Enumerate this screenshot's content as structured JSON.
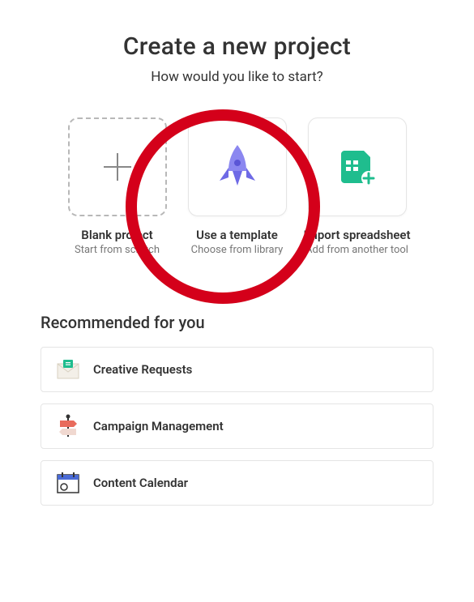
{
  "header": {
    "title": "Create a new project",
    "subtitle": "How would you like to start?"
  },
  "cards": [
    {
      "title": "Blank project",
      "desc": "Start from scratch",
      "icon": "plus"
    },
    {
      "title": "Use a template",
      "desc": "Choose from library",
      "icon": "rocket"
    },
    {
      "title": "Import spreadsheet",
      "desc": "Add from another tool",
      "icon": "spreadsheet"
    }
  ],
  "recommended": {
    "heading": "Recommended for you",
    "items": [
      {
        "label": "Creative Requests",
        "icon": "envelope"
      },
      {
        "label": "Campaign Management",
        "icon": "signpost"
      },
      {
        "label": "Content Calendar",
        "icon": "calendar"
      }
    ]
  },
  "colors": {
    "rocket": "#6e6ae6",
    "spreadsheet": "#1fbd8e",
    "highlight": "#d4001a"
  }
}
